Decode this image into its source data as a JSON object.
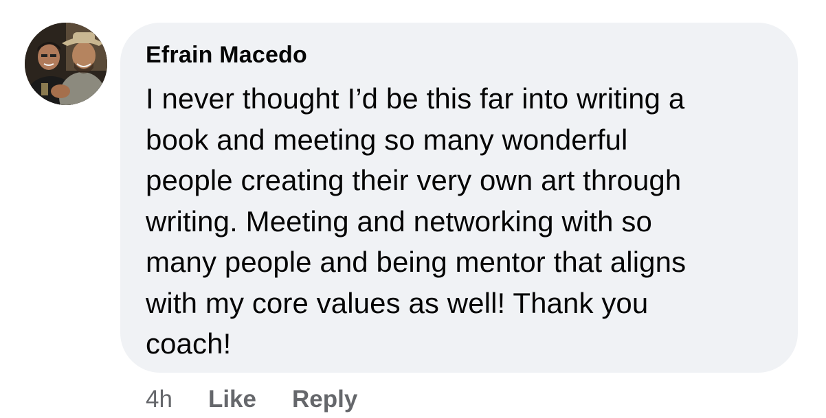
{
  "comment": {
    "author": "Efrain Macedo",
    "text": "I never thought I’d be this far into writing a\nbook and meeting so many wonderful\npeople creating their very own art through\nwriting. Meeting and networking with so\nmany people and being mentor that aligns\nwith my core values as well! Thank you\ncoach!",
    "time": "4h",
    "like_label": "Like",
    "reply_label": "Reply"
  },
  "colors": {
    "bubble_background": "#f0f2f5",
    "primary_text": "#050505",
    "secondary_text": "#65676b"
  }
}
